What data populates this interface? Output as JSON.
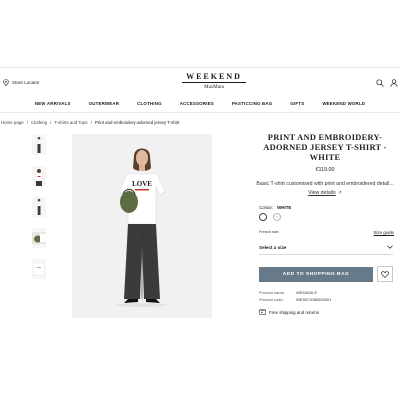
{
  "header": {
    "store_locator": "Store Locator",
    "logo_main": "WEEKEND",
    "logo_sub": "MaxMara",
    "icons": [
      "pin-icon",
      "search-icon",
      "user-icon"
    ]
  },
  "nav": {
    "items": [
      "NEW ARRIVALS",
      "OUTERWEAR",
      "CLOTHING",
      "ACCESSORIES",
      "PASTICCINO BAG",
      "GIFTS",
      "WEEKEND WORLD"
    ]
  },
  "breadcrumb": {
    "items": [
      "Home page",
      "Clothing",
      "T-shirts and Tops",
      "Print and embroidery-adorned jersey T-shirt"
    ],
    "separator": "/"
  },
  "gallery": {
    "thumbnails": [
      "full-length-front",
      "top-front",
      "full-length-side",
      "bag-detail",
      "folded-shirt"
    ],
    "main_image": "model-wearing-t-shirt",
    "shirt_text": "LOVE"
  },
  "product": {
    "title": "PRINT AND EMBROIDERY-ADORNED JERSEY T-SHIRT - WHITE",
    "price": "€119.00",
    "description": "Basic T-shirt customised with print and embroidered detail... ",
    "details_link": "View details",
    "colour_label": "Colour:",
    "colour_value": "WHITE",
    "colors": {
      "swatch": "#ffffff",
      "button": "#667a8a",
      "text": "#1a1a1a"
    },
    "french_size": "French size",
    "size_guide": "Size guide",
    "size_select": "Select a size",
    "add_button": "ADD TO SHOPPING BAG",
    "product_name_label": "Product name:",
    "product_name_value": "WKDAGILE",
    "product_code_label": "Product code:",
    "product_code_value": "WE5971066006001",
    "shipping": "Free shipping and returns"
  }
}
